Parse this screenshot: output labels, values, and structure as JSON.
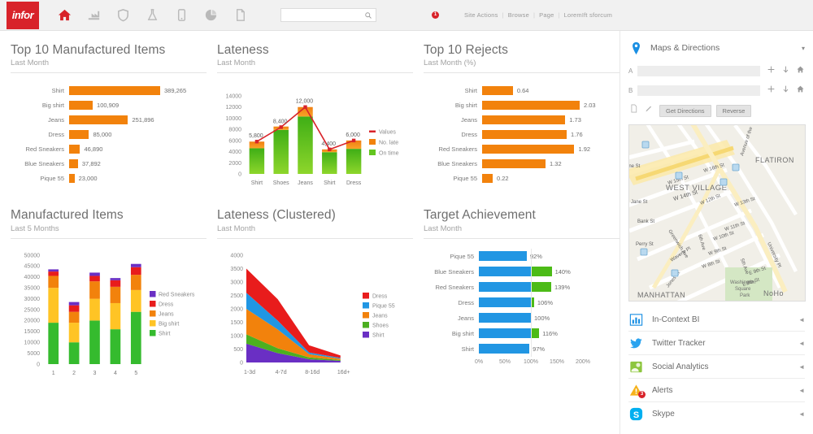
{
  "topbar": {
    "logo_text": "infor",
    "search": {
      "value": "",
      "placeholder": ""
    },
    "nav_icons": [
      "home-icon",
      "factory-icon",
      "shield-icon",
      "flask-icon",
      "device-icon",
      "pie-chart-icon",
      "document-icon"
    ],
    "action_icons": [
      "mail-icon",
      "share-icon",
      "comment-icon",
      "notification-icon"
    ],
    "notification_count": "1",
    "links": [
      "Site Actions",
      "Browse",
      "Page",
      "LoremIft sforcum"
    ],
    "separator": "|",
    "far_icons": [
      "location-pin-icon",
      "bi-chart-icon",
      "twitter-icon",
      "social-analytics-icon",
      "alerts-icon",
      "skype-icon",
      "settings-icon"
    ]
  },
  "panels": {
    "top_manufactured": {
      "title": "Top 10 Manufactured Items",
      "subtitle": "Last Month"
    },
    "lateness": {
      "title": "Lateness",
      "subtitle": "Last Month"
    },
    "rejects": {
      "title": "Top 10 Rejects",
      "subtitle": "Last Month (%)"
    },
    "manufactured_items": {
      "title": "Manufactured Items",
      "subtitle": "Last 5 Months"
    },
    "lateness_clustered": {
      "title": "Lateness (Clustered)",
      "subtitle": "Last Month"
    },
    "target_achievement": {
      "title": "Target Achievement",
      "subtitle": "Last Month"
    }
  },
  "chart_data": [
    {
      "id": "top_manufactured",
      "type": "bar",
      "orientation": "horizontal",
      "title": "Top 10 Manufactured Items",
      "subtitle": "Last Month",
      "categories": [
        "Shirt",
        "Big shirt",
        "Jeans",
        "Dress",
        "Red Sneakers",
        "Blue Sneakers",
        "Pique 55"
      ],
      "values": [
        389265,
        100909,
        251896,
        85000,
        46890,
        37892,
        23000
      ],
      "value_labels": [
        "389,265",
        "100,909",
        "251,896",
        "85,000",
        "46,890",
        "37,892",
        "23,000"
      ],
      "color": "#f2820c",
      "xlabel": "",
      "ylabel": "",
      "grid": false
    },
    {
      "id": "lateness",
      "type": "bar",
      "variant": "stacked-column-with-line",
      "title": "Lateness",
      "subtitle": "Last Month",
      "categories": [
        "Shirt",
        "Shoes",
        "Jeans",
        "Shirt",
        "Dress"
      ],
      "series": [
        {
          "name": "On time",
          "values": [
            4600,
            7900,
            10300,
            3900,
            4500
          ],
          "color": "#63c520"
        },
        {
          "name": "No. late",
          "values": [
            1200,
            600,
            1700,
            500,
            1500
          ],
          "color": "#f2820c"
        },
        {
          "name": "Values",
          "values": [
            5800,
            8400,
            12000,
            4400,
            6000
          ],
          "color": "#d8232a",
          "type": "line"
        }
      ],
      "data_labels": [
        "5,800",
        "8,400",
        "12,000",
        "4,400",
        "6,000"
      ],
      "legend": [
        "Values",
        "No. late",
        "On time"
      ],
      "legend_position": "right",
      "yticks": [
        0,
        2000,
        4000,
        6000,
        8000,
        10000,
        12000,
        14000
      ],
      "ylim": [
        0,
        14000
      ],
      "grid": false
    },
    {
      "id": "rejects",
      "type": "bar",
      "orientation": "horizontal",
      "title": "Top 10 Rejects",
      "subtitle": "Last Month (%)",
      "categories": [
        "Shirt",
        "Big shirt",
        "Jeans",
        "Dress",
        "Red Sneakers",
        "Blue Sneakers",
        "Pique 55"
      ],
      "values": [
        0.64,
        2.03,
        1.73,
        1.76,
        1.92,
        1.32,
        0.22
      ],
      "value_labels": [
        "0.64",
        "2.03",
        "1.73",
        "1.76",
        "1.92",
        "1.32",
        "0.22"
      ],
      "color": "#f2820c",
      "xlabel": "",
      "ylabel": "%",
      "grid": false
    },
    {
      "id": "manufactured_items",
      "type": "bar",
      "variant": "stacked",
      "title": "Manufactured Items",
      "subtitle": "Last 5 Months",
      "categories": [
        "1",
        "2",
        "3",
        "4",
        "5"
      ],
      "series": [
        {
          "name": "Shirt",
          "values": [
            19000,
            10000,
            20000,
            16000,
            24000
          ],
          "color": "#35bb2e"
        },
        {
          "name": "Big shirt",
          "values": [
            16000,
            9000,
            10000,
            12000,
            10000
          ],
          "color": "#ffc425"
        },
        {
          "name": "Jeans",
          "values": [
            5500,
            5000,
            8000,
            7500,
            7000
          ],
          "color": "#f2820c"
        },
        {
          "name": "Dress",
          "values": [
            2000,
            3000,
            2500,
            3000,
            3500
          ],
          "color": "#e81c1c"
        },
        {
          "name": "Red Sneakers",
          "values": [
            1000,
            1500,
            1500,
            1000,
            1500
          ],
          "color": "#6a2fc4"
        }
      ],
      "legend": [
        "Red Sneakers",
        "Dress",
        "Jeans",
        "Big shirt",
        "Shirt"
      ],
      "legend_position": "right",
      "yticks": [
        0,
        5000,
        10000,
        15000,
        20000,
        25000,
        30000,
        35000,
        40000,
        45000,
        50000
      ],
      "ylim": [
        0,
        50000
      ],
      "grid": false
    },
    {
      "id": "lateness_clustered",
      "type": "area",
      "variant": "stacked",
      "title": "Lateness (Clustered)",
      "subtitle": "Last Month",
      "x": [
        "1-3d",
        "4-7d",
        "8-16d",
        "16d+"
      ],
      "series": [
        {
          "name": "Shirt",
          "values": [
            700,
            350,
            120,
            60
          ],
          "color": "#6a2fc4"
        },
        {
          "name": "Shoes",
          "values": [
            350,
            180,
            70,
            30
          ],
          "color": "#4caf20"
        },
        {
          "name": "Jeans",
          "values": [
            950,
            700,
            120,
            50
          ],
          "color": "#f2820c"
        },
        {
          "name": "Pique 55",
          "values": [
            600,
            330,
            60,
            30
          ],
          "color": "#2196e3"
        },
        {
          "name": "Dress",
          "values": [
            900,
            800,
            270,
            90
          ],
          "color": "#e81c1c"
        }
      ],
      "legend": [
        "Dress",
        "Pique 55",
        "Jeans",
        "Shoes",
        "Shirt"
      ],
      "legend_position": "right",
      "yticks": [
        0,
        500,
        1000,
        1500,
        2000,
        2500,
        3000,
        3500,
        4000
      ],
      "ylim": [
        0,
        4000
      ],
      "grid": false
    },
    {
      "id": "target_achievement",
      "type": "bar",
      "orientation": "horizontal",
      "variant": "target",
      "title": "Target Achievement",
      "subtitle": "Last Month",
      "categories": [
        "Pique 55",
        "Blue Sneakers",
        "Red Sneakers",
        "Dress",
        "Jeans",
        "Big shirt",
        "Shirt"
      ],
      "values": [
        92,
        140,
        139,
        106,
        100,
        116,
        97
      ],
      "value_labels": [
        "92%",
        "140%",
        "139%",
        "106%",
        "100%",
        "116%",
        "97%"
      ],
      "xticks": [
        "0%",
        "50%",
        "100%",
        "150%",
        "200%"
      ],
      "xlim": [
        0,
        200
      ],
      "base_color": "#2196e3",
      "over_color": "#4cbb17",
      "target_line": 100,
      "grid": false
    }
  ],
  "sidebar": {
    "maps": {
      "title": "Maps & Directions",
      "caret": "▾",
      "field_a_label": "A",
      "field_b_label": "B",
      "field_a_value": "",
      "field_b_value": "",
      "get_directions_label": "Get Directions",
      "reverse_label": "Reverse"
    },
    "map_labels": {
      "neighborhoods": [
        "WEST VILLAGE",
        "FLATIRON",
        "MANHATTAN",
        "NoHo"
      ],
      "park": "Washington Square Park",
      "streets": [
        "W 15th St",
        "W 16th St",
        "W 14th St",
        "Jane St",
        "Bank St",
        "Perry St",
        "Greenwich Ave",
        "6th Ave",
        "W 12th St",
        "W 13th St",
        "W 11th St",
        "W 10th St",
        "W 9th St",
        "W 8th St",
        "Waverly Pl",
        "Jones St",
        "E 9th St",
        "E 8th St",
        "University Pl",
        "5th Ave",
        "Avenue of the Americas"
      ]
    },
    "items": [
      {
        "label": "In-Context BI",
        "icon": "bi-chart-icon",
        "caret": "◄"
      },
      {
        "label": "Twitter Tracker",
        "icon": "twitter-icon",
        "caret": "◄"
      },
      {
        "label": "Social Analytics",
        "icon": "social-analytics-icon",
        "caret": "◄"
      },
      {
        "label": "Alerts",
        "icon": "alerts-icon",
        "caret": "◄",
        "badge": "3"
      },
      {
        "label": "Skype",
        "icon": "skype-icon",
        "caret": "◄"
      }
    ]
  }
}
